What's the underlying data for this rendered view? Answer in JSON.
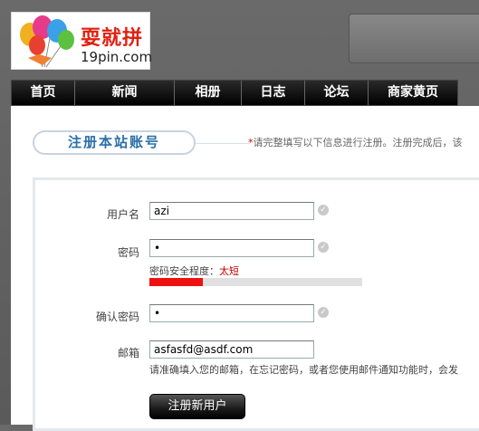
{
  "logo": {
    "cn_text": "耍就拼",
    "en_text": "19pin.com"
  },
  "nav": {
    "items": [
      "首页",
      "新闻",
      "相册",
      "日志",
      "论坛",
      "商家黄页"
    ]
  },
  "page": {
    "title": "注册本站账号",
    "notice_star": "*",
    "notice": "请完整填写以下信息进行注册。注册完成后，该"
  },
  "form": {
    "username": {
      "label": "用户名",
      "value": "azi"
    },
    "password": {
      "label": "密码",
      "value": "•"
    },
    "strength": {
      "label": "密码安全程度：",
      "value": "太短",
      "level_percent": 25
    },
    "confirm": {
      "label": "确认密码",
      "value": "•"
    },
    "email": {
      "label": "邮箱",
      "value": "asfasfd@asdf.com",
      "hint": "请准确填入您的邮箱，在忘记密码，或者您使用邮件通知功能时，会发"
    },
    "submit_label": "注册新用户"
  },
  "colors": {
    "accent": "#2a6fa8",
    "strength_bar": "#ee1111",
    "warning_text": "#cc0000"
  }
}
